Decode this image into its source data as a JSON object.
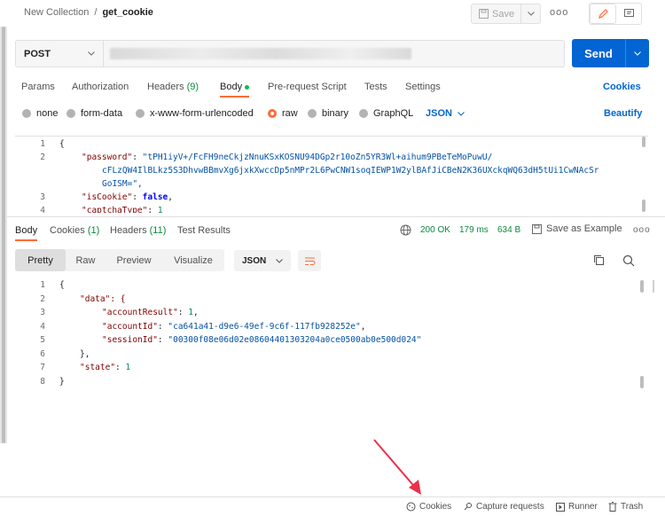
{
  "breadcrumb": {
    "parent": "New Collection",
    "separator": "/",
    "current": "get_cookie"
  },
  "header": {
    "save_label": "Save",
    "more_label": "ooo"
  },
  "request": {
    "method": "POST",
    "send_label": "Send"
  },
  "request_tabs": [
    {
      "label": "Params"
    },
    {
      "label": "Authorization"
    },
    {
      "label": "Headers",
      "count": "(9)"
    },
    {
      "label": "Body"
    },
    {
      "label": "Pre-request Script"
    },
    {
      "label": "Tests"
    },
    {
      "label": "Settings"
    }
  ],
  "cookies_link": "Cookies",
  "body_types": [
    "none",
    "form-data",
    "x-www-form-urlencoded",
    "raw",
    "binary",
    "GraphQL"
  ],
  "body_format": "JSON",
  "beautify_label": "Beautify",
  "request_body": [
    {
      "n": "1",
      "text": "{"
    },
    {
      "n": "2",
      "key": "\"password\"",
      "val": "\"tPH1iyV+/FcFH9neCkjzNnuKSxKOSNU94DGp2r10oZn5YR3Wl+aihum9PBeTeMoPuwU/"
    },
    {
      "n": "",
      "cont": "cFLzQW4IlBLkz5S3DhvwBBmvXg6jxkXwccDp5nMPr2L6PwCNW1soqIEWP1W2ylBAfJiCBeN2K36UXckqWQ63dH5tUi1CwNAcSr"
    },
    {
      "n": "",
      "cont": "GoISM=\","
    },
    {
      "n": "3",
      "key": "\"isCookie\"",
      "bool": "false"
    },
    {
      "n": "4",
      "key": "\"captchaType\"",
      "num": "1"
    }
  ],
  "response_tabs": [
    {
      "label": "Body"
    },
    {
      "label": "Cookies",
      "count": "(1)"
    },
    {
      "label": "Headers",
      "count": "(11)"
    },
    {
      "label": "Test Results"
    }
  ],
  "response_meta": {
    "status": "200 OK",
    "time": "179 ms",
    "size": "634 B",
    "save_example": "Save as Example",
    "more": "ooo"
  },
  "view_tabs": [
    "Pretty",
    "Raw",
    "Preview",
    "Visualize"
  ],
  "response_format": "JSON",
  "response_body": [
    {
      "n": "1",
      "text": "{"
    },
    {
      "n": "2",
      "text": "\"data\": {"
    },
    {
      "n": "3",
      "key": "\"accountResult\"",
      "num": "1"
    },
    {
      "n": "4",
      "key": "\"accountId\"",
      "val": "\"ca641a41-d9e6-49ef-9c6f-117fb928252e\""
    },
    {
      "n": "5",
      "key": "\"sessionId\"",
      "val": "\"00300f08e06d02e08604401303204a0ce0500ab0e500d024\""
    },
    {
      "n": "6",
      "text": "},"
    },
    {
      "n": "7",
      "key": "\"state\"",
      "num": "1"
    },
    {
      "n": "8",
      "text": "}"
    }
  ],
  "statusbar": {
    "cookies": "Cookies",
    "capture": "Capture requests",
    "runner": "Runner",
    "trash": "Trash"
  },
  "colors": {
    "accent": "#ff6c37",
    "send": "#0265d2",
    "status_ok": "#0a8a3e",
    "arrow": "#e8314b"
  }
}
